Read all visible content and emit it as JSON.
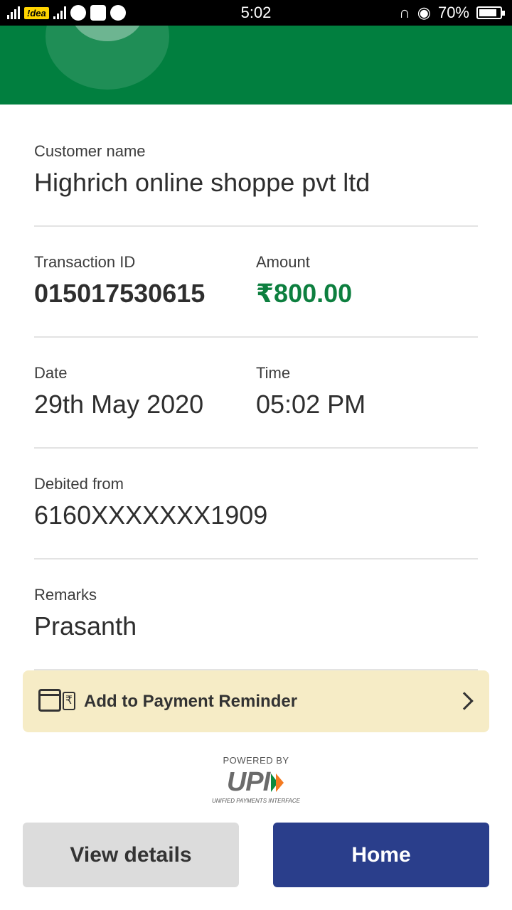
{
  "status_bar": {
    "carrier": "!dea",
    "time": "5:02",
    "battery": "70%",
    "battery_level": 0.7
  },
  "details": {
    "customer_name_label": "Customer name",
    "customer_name": "Highrich online shoppe pvt ltd",
    "transaction_id_label": "Transaction ID",
    "transaction_id": "015017530615",
    "amount_label": "Amount",
    "amount": "₹800.00",
    "date_label": "Date",
    "date": "29th May 2020",
    "time_label": "Time",
    "time": "05:02 PM",
    "debited_from_label": "Debited from",
    "debited_from": "6160XXXXXXX1909",
    "remarks_label": "Remarks",
    "remarks": "Prasanth"
  },
  "reminder": {
    "label": "Add to Payment Reminder",
    "icon": "calendar-rupee-icon"
  },
  "upi": {
    "powered_by": "POWERED BY",
    "logo": "UPI",
    "tagline": "UNIFIED PAYMENTS INTERFACE"
  },
  "buttons": {
    "view_details": "View details",
    "home": "Home"
  },
  "colors": {
    "header_green": "#017f3f",
    "amount_green": "#0d7f3f",
    "reminder_bg": "#f6ecc6",
    "home_blue": "#2a3e8b"
  }
}
